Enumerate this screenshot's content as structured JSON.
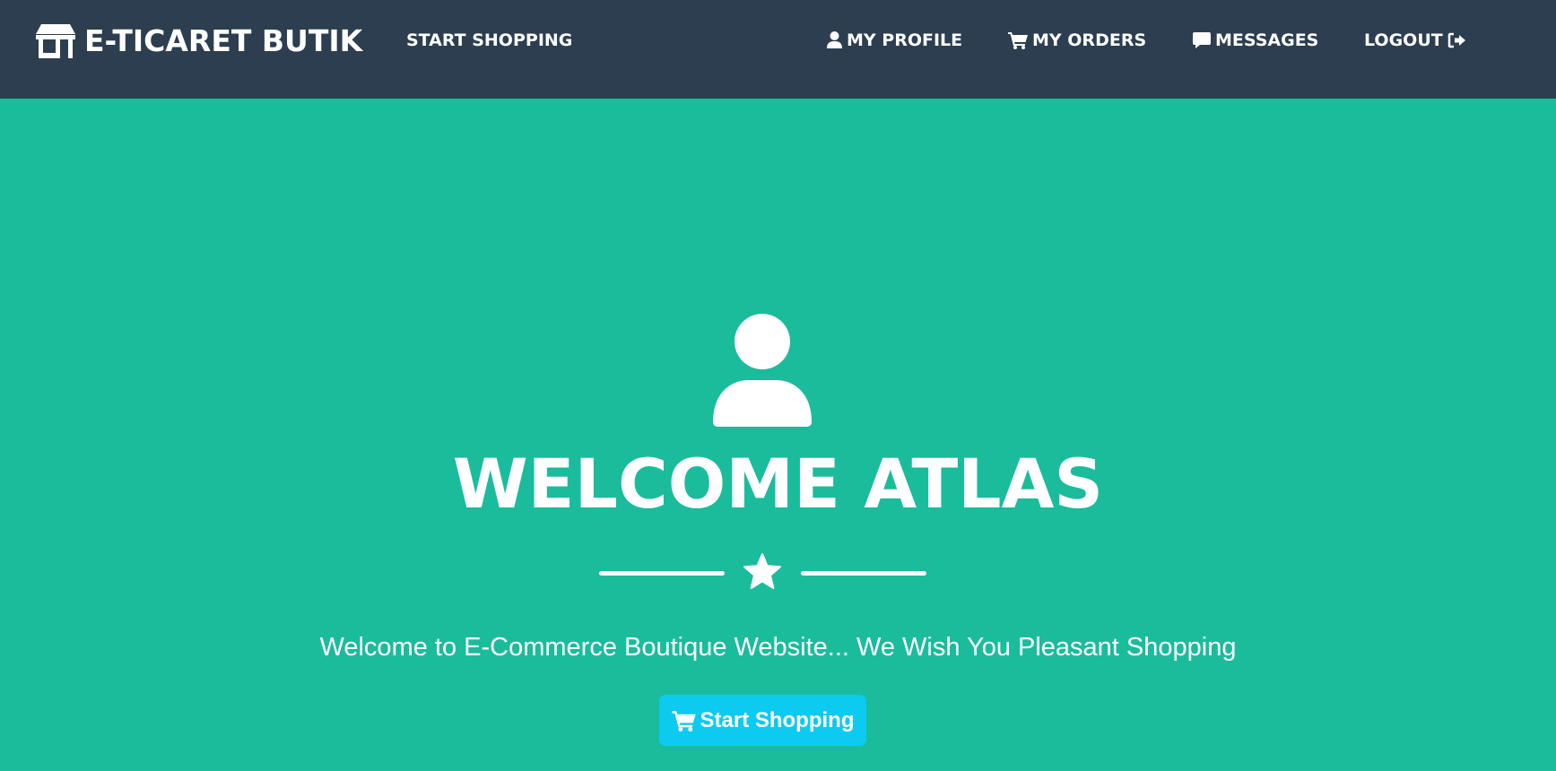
{
  "colors": {
    "navbar_bg": "#2c3e50",
    "masthead_bg": "#1abc9c",
    "button_bg": "#0dcaf0",
    "text": "#ffffff"
  },
  "navbar": {
    "brand": {
      "label": "E-TICARET BUTIK",
      "icon": "store-icon"
    },
    "links": {
      "start_shopping": {
        "label": "START SHOPPING"
      },
      "profile": {
        "label": "MY PROFILE",
        "icon": "user-icon"
      },
      "orders": {
        "label": "MY ORDERS",
        "icon": "cart-icon"
      },
      "messages": {
        "label": "MESSAGES",
        "icon": "message-icon"
      },
      "logout": {
        "label": "LOGOUT",
        "icon": "sign-out-icon"
      }
    }
  },
  "masthead": {
    "avatar_icon": "user-icon",
    "title": "WELCOME ATLAS",
    "divider_icon": "star-icon",
    "lead": "Welcome to E-Commerce Boutique Website... We Wish You Pleasant Shopping",
    "cta": {
      "label": "Start Shopping",
      "icon": "cart-icon"
    }
  }
}
